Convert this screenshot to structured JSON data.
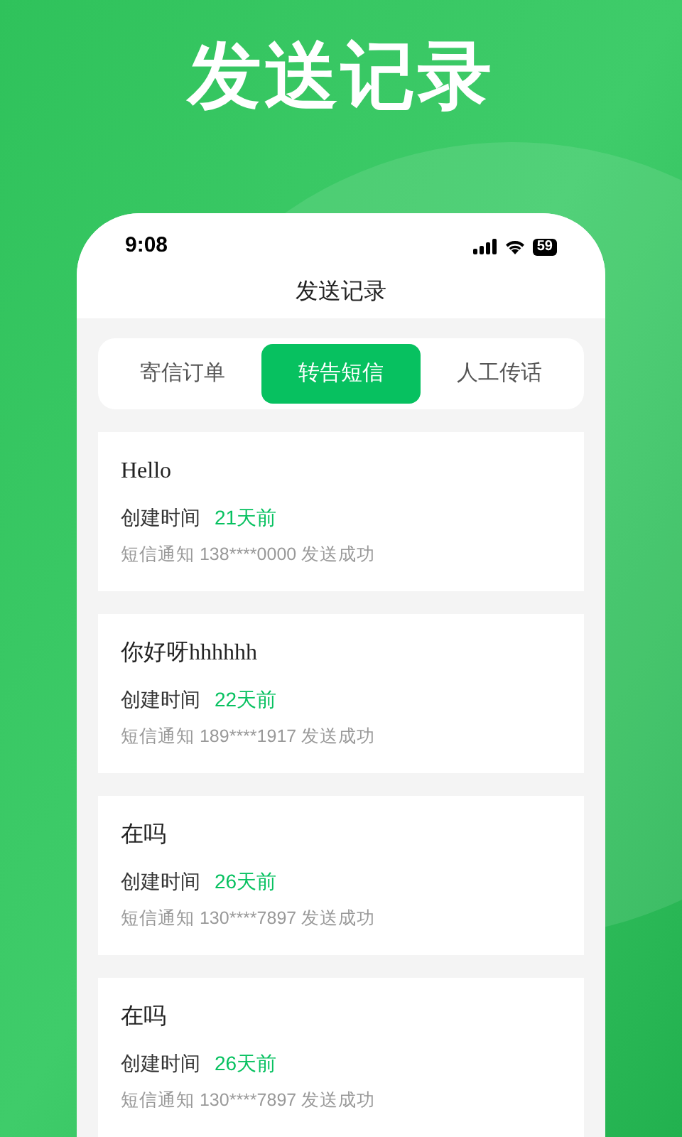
{
  "headline": "发送记录",
  "status_bar": {
    "time": "9:08",
    "battery": "59"
  },
  "screen": {
    "title": "发送记录"
  },
  "tabs": [
    {
      "label": "寄信订单",
      "selected": false
    },
    {
      "label": "转告短信",
      "selected": true
    },
    {
      "label": "人工传话",
      "selected": false
    }
  ],
  "records": [
    {
      "message": "Hello",
      "created_label": "创建时间",
      "created_ago": "21天前",
      "detail": "短信通知 138****0000 发送成功"
    },
    {
      "message": "你好呀hhhhhh",
      "created_label": "创建时间",
      "created_ago": "22天前",
      "detail": "短信通知 189****1917 发送成功"
    },
    {
      "message": "在吗",
      "created_label": "创建时间",
      "created_ago": "26天前",
      "detail": "短信通知 130****7897 发送成功"
    },
    {
      "message": "在吗",
      "created_label": "创建时间",
      "created_ago": "26天前",
      "detail": "短信通知 130****7897 发送成功"
    }
  ]
}
